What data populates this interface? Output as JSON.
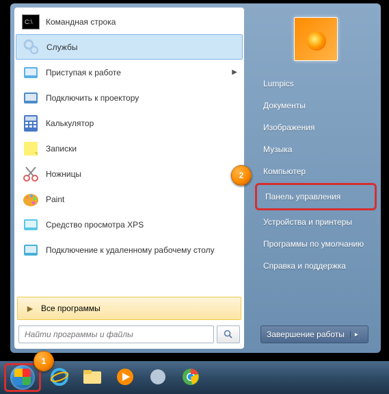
{
  "programs": [
    {
      "label": "Командная строка",
      "icon": "cmd"
    },
    {
      "label": "Службы",
      "icon": "services",
      "selected": true
    },
    {
      "label": "Приступая к работе",
      "icon": "getting-started",
      "submenu": true
    },
    {
      "label": "Подключить к проектору",
      "icon": "projector"
    },
    {
      "label": "Калькулятор",
      "icon": "calculator"
    },
    {
      "label": "Записки",
      "icon": "sticky-notes"
    },
    {
      "label": "Ножницы",
      "icon": "snipping"
    },
    {
      "label": "Paint",
      "icon": "paint"
    },
    {
      "label": "Средство просмотра XPS",
      "icon": "xps"
    },
    {
      "label": "Подключение к удаленному рабочему столу",
      "icon": "rdp"
    }
  ],
  "all_programs": "Все программы",
  "search": {
    "placeholder": "Найти программы и файлы"
  },
  "right_items": [
    {
      "label": "Lumpics"
    },
    {
      "label": "Документы"
    },
    {
      "label": "Изображения"
    },
    {
      "label": "Музыка"
    },
    {
      "label": "Компьютер"
    },
    {
      "label": "Панель управления",
      "highlighted": true
    },
    {
      "label": "Устройства и принтеры"
    },
    {
      "label": "Программы по умолчанию"
    },
    {
      "label": "Справка и поддержка"
    }
  ],
  "shutdown": "Завершение работы",
  "badges": {
    "one": "1",
    "two": "2"
  },
  "taskbar_icons": [
    "ie",
    "explorer",
    "media-player",
    "generic",
    "chrome"
  ],
  "icon_colors": {
    "cmd": "#1a1a1a",
    "services": "#a8c8e8",
    "getting-started": "#5ab0e8",
    "projector": "#4a8cc8",
    "calculator": "#4878c8",
    "sticky-notes": "#fff176",
    "snipping": "#e85a5a",
    "paint": "#f0a830",
    "xps": "#58c8e8",
    "rdp": "#48b0d8"
  }
}
